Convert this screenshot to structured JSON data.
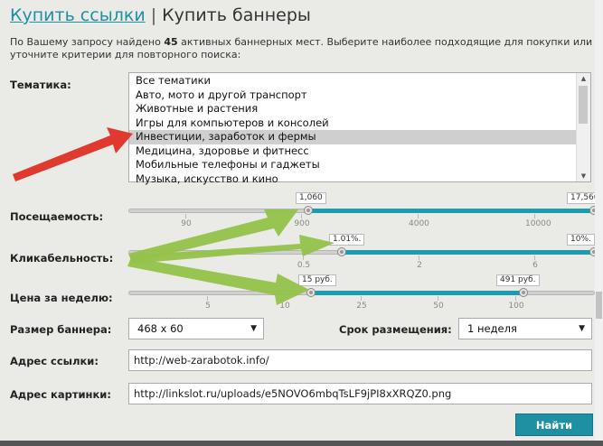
{
  "header": {
    "tab_links": "Купить ссылки",
    "separator": "|",
    "tab_banners": "Купить баннеры"
  },
  "intro": {
    "prefix": "По Вашему запросу найдено",
    "count": "45",
    "suffix": "активных баннерных мест. Выберите наиболее подходящие для покупки или уточните критерии для повторного поиска:"
  },
  "topics": {
    "label": "Тематика:",
    "selected_index": 4,
    "options": [
      "Все тематики",
      "Авто, мото и другой транспорт",
      "Животные и растения",
      "Игры для компьютеров и консолей",
      "Инвестиции, заработок и фермы",
      "Медицина, здоровье и фитнесс",
      "Мобильные телефоны и гаджеты",
      "Музыка, искусство и кино"
    ]
  },
  "sliders": [
    {
      "key": "traffic",
      "label": "Посещаемость:",
      "low": "1,060",
      "high": "17,560",
      "ticks": [
        "90",
        "900",
        "4000",
        "10000"
      ]
    },
    {
      "key": "ctr",
      "label": "Кликабельность:",
      "low": "1.01%.",
      "high": "10%.",
      "ticks": [
        "0.5",
        "2",
        "6"
      ]
    },
    {
      "key": "price",
      "label": "Цена за неделю:",
      "low": "15 руб.",
      "high": "491 руб.",
      "ticks": [
        "5",
        "10",
        "25",
        "50",
        "100"
      ]
    }
  ],
  "banner_size": {
    "label": "Размер баннера:",
    "value": "468 x 60"
  },
  "duration": {
    "label": "Срок размещения:",
    "value": "1 неделя"
  },
  "link_address": {
    "label": "Адрес ссылки:",
    "value": "http://web-zarabotok.info/"
  },
  "image_address": {
    "label": "Адрес картинки:",
    "value": "http://linkslot.ru/uploads/e5NOVO6mbqTsLF9jPI8xXRQZ0.png"
  },
  "submit": {
    "label": "Найти"
  },
  "colors": {
    "accent": "#1f8fa4",
    "slider_fill": "#1c9cb0",
    "red_arrow": "#e03a2e",
    "green_arrow": "#93c24a"
  }
}
